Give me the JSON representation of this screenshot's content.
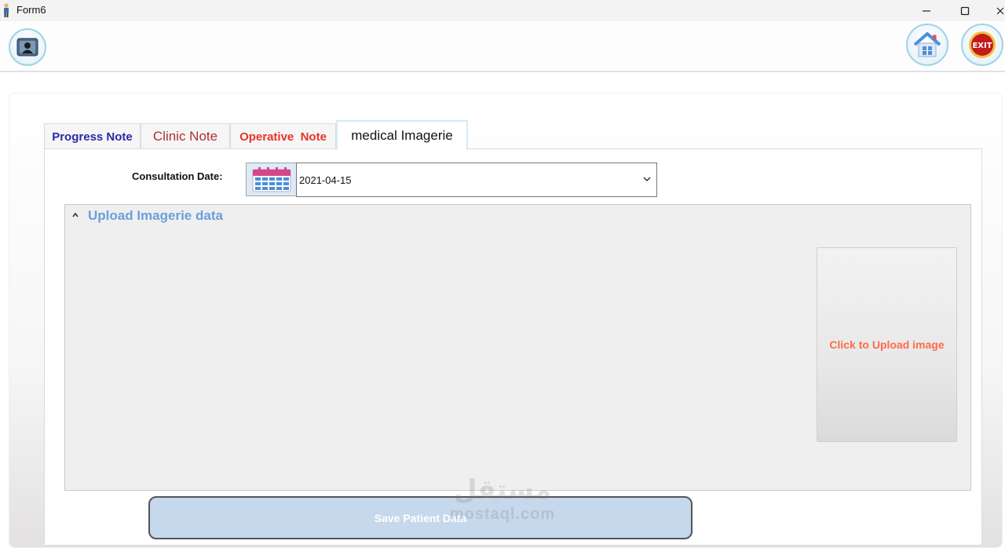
{
  "window": {
    "title": "Form6"
  },
  "tabs": {
    "progress": "Progress Note",
    "clinic": "Clinic Note",
    "operative": "Operative  Note",
    "medical": "medical Imagerie"
  },
  "form": {
    "date_label": "Consultation Date:",
    "date_value": "2021-04-15",
    "upload_section_title": "Upload Imagerie data",
    "upload_image_label": "Click to Upload image",
    "save_label": "Save Patient Data"
  },
  "toolbar": {
    "exit_label": "EXIT"
  },
  "watermark": {
    "arabic": "مستقل",
    "latin": "mostaql.com"
  },
  "colors": {
    "accent_blue": "#6a9fdc",
    "upload_text": "#ff6b4a",
    "save_button": "#c6d8ec"
  }
}
